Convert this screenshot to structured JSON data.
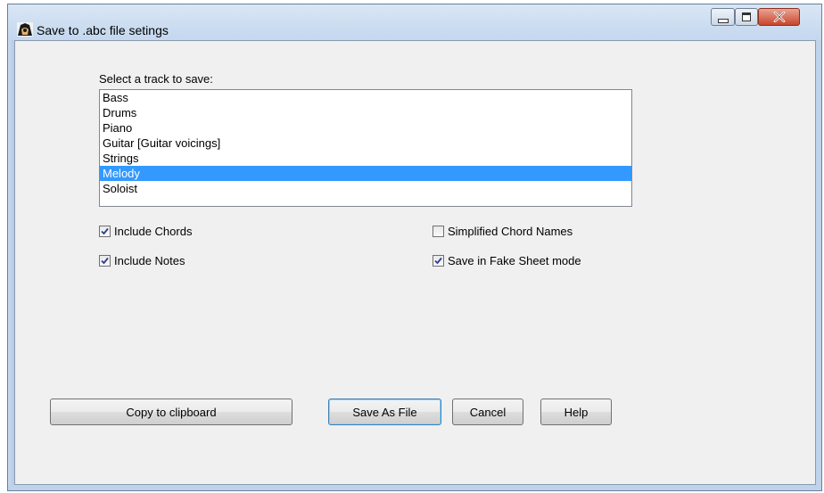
{
  "window": {
    "title": "Save to .abc file setings",
    "controls": {
      "minimize": "minimize",
      "maximize": "maximize",
      "close": "close"
    }
  },
  "tracks": {
    "label": "Select a track to save:",
    "items": [
      "Bass",
      "Drums",
      "Piano",
      "Guitar [Guitar voicings]",
      "Strings",
      "Melody",
      "Soloist"
    ],
    "selected": "Melody"
  },
  "options": {
    "include_chords": {
      "label": "Include Chords",
      "checked": true
    },
    "include_notes": {
      "label": "Include Notes",
      "checked": true
    },
    "simplified_chord_names": {
      "label": "Simplified Chord Names",
      "checked": false
    },
    "fake_sheet_mode": {
      "label": "Save in Fake Sheet mode",
      "checked": true
    }
  },
  "buttons": {
    "copy": "Copy to clipboard",
    "save": "Save As File",
    "cancel": "Cancel",
    "help": "Help"
  },
  "colors": {
    "selection": "#3399ff",
    "close_button": "#c9462b"
  }
}
